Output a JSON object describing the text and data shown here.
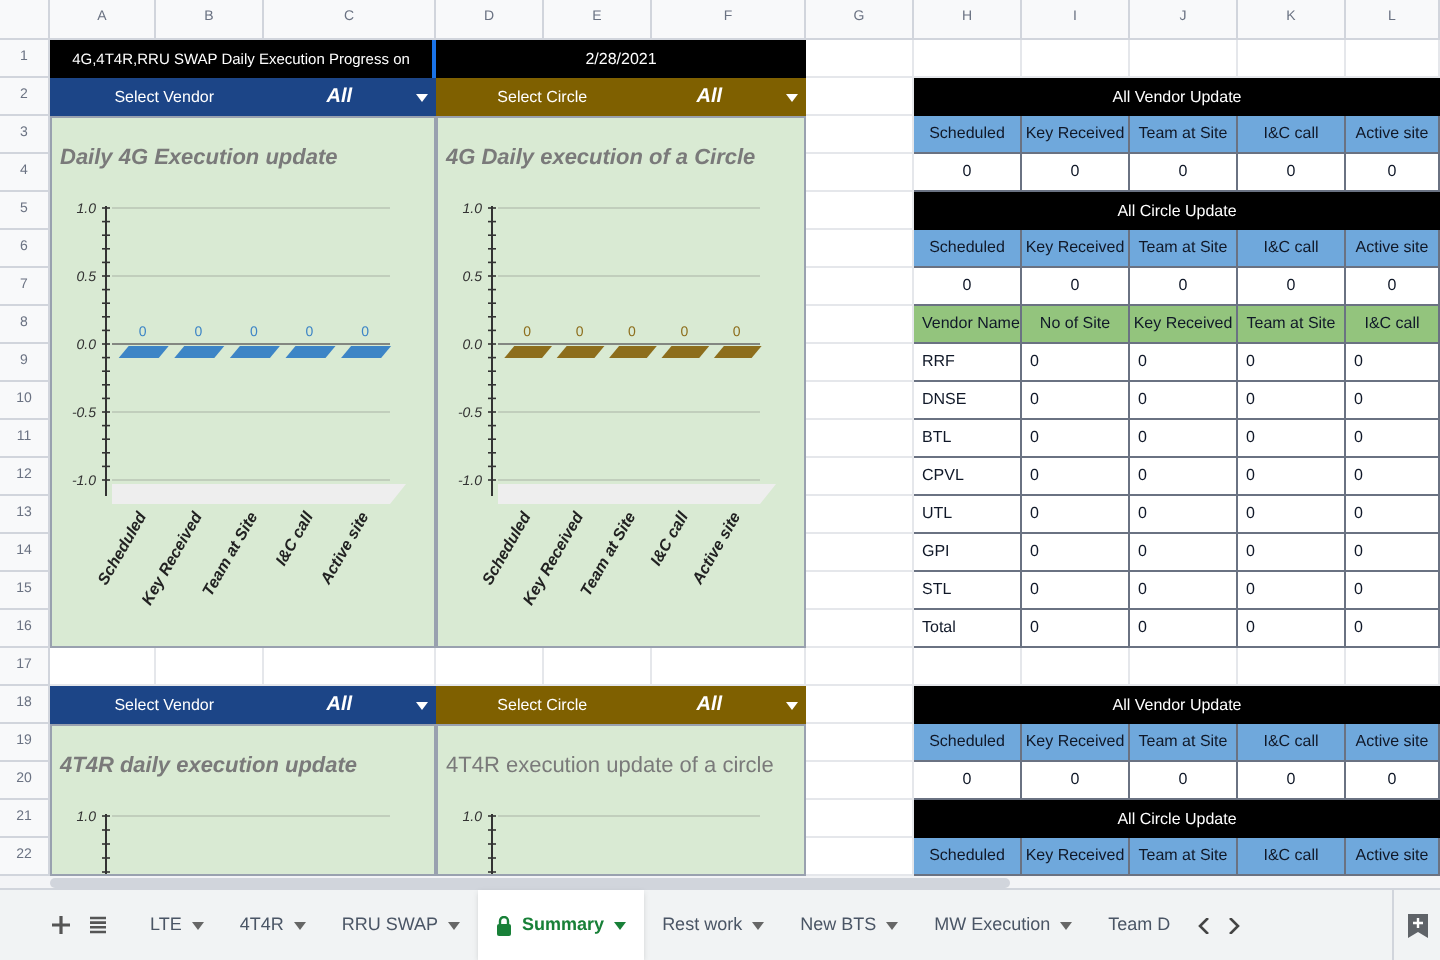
{
  "sheet": {
    "column_headers": [
      "A",
      "B",
      "C",
      "D",
      "E",
      "F",
      "G",
      "H",
      "I",
      "J",
      "K",
      "L"
    ],
    "row_numbers": [
      "1",
      "2",
      "3",
      "4",
      "5",
      "6",
      "7",
      "8",
      "9",
      "10",
      "11",
      "12",
      "13",
      "14",
      "15",
      "16",
      "17",
      "18",
      "19",
      "20",
      "21",
      "22"
    ]
  },
  "header": {
    "title": "4G,4T4R,RRU SWAP Daily Execution Progress on",
    "date": "2/28/2021"
  },
  "top_filters": [
    {
      "kind": "vendor",
      "label": "Select Vendor",
      "value": "All"
    },
    {
      "kind": "circle",
      "label": "Select Circle",
      "value": "All"
    }
  ],
  "top_charts": [
    {
      "title": "Daily 4G Execution update",
      "title_italic": true,
      "chart_data": {
        "type": "bar",
        "categories": [
          "Scheduled",
          "Key Received",
          "Team at Site",
          "I&C call",
          "Active site"
        ],
        "series": [
          {
            "color": "#3d85c6",
            "values": [
              0,
              0,
              0,
              0,
              0
            ]
          }
        ],
        "ylim": [
          -1,
          1
        ],
        "yticks": [
          {
            "value": 1,
            "label": "1.0"
          },
          {
            "value": 0.5,
            "label": "0.5"
          },
          {
            "value": 0,
            "label": "0.0"
          },
          {
            "value": -0.5,
            "label": "-0.5"
          },
          {
            "value": -1,
            "label": "-1.0"
          }
        ],
        "data_labels": true
      }
    },
    {
      "title": "4G Daily execution of a Circle",
      "title_italic": true,
      "chart_data": {
        "type": "bar",
        "categories": [
          "Scheduled",
          "Key Received",
          "Team at Site",
          "I&C call",
          "Active site"
        ],
        "series": [
          {
            "color": "#8d6e1c",
            "values": [
              0,
              0,
              0,
              0,
              0
            ]
          }
        ],
        "ylim": [
          -1,
          1
        ],
        "yticks": [
          {
            "value": 1,
            "label": "1.0"
          },
          {
            "value": 0.5,
            "label": "0.5"
          },
          {
            "value": 0,
            "label": "0.0"
          },
          {
            "value": -0.5,
            "label": "-0.5"
          },
          {
            "value": -1,
            "label": "-1.0"
          }
        ],
        "data_labels": true
      }
    }
  ],
  "bottom_filters": [
    {
      "kind": "vendor",
      "label": "Select Vendor",
      "value": "All"
    },
    {
      "kind": "circle",
      "label": "Select Circle",
      "value": "All"
    }
  ],
  "bottom_charts": [
    {
      "title": "4T4R daily execution update",
      "title_italic": true,
      "visible_tick": "1.0"
    },
    {
      "title": "4T4R execution update of a circle",
      "title_italic": false,
      "visible_tick": "1.0"
    }
  ],
  "summary_blocks": [
    {
      "rows": [
        {
          "kind": "title",
          "text": "All Vendor Update"
        },
        {
          "kind": "header",
          "cells": [
            "Scheduled",
            "Key Received",
            "Team at Site",
            "I&C call",
            "Active site"
          ]
        },
        {
          "kind": "values",
          "cells": [
            "0",
            "0",
            "0",
            "0",
            "0"
          ]
        },
        {
          "kind": "title",
          "text": "All Circle Update"
        },
        {
          "kind": "header",
          "cells": [
            "Scheduled",
            "Key Received",
            "Team at Site",
            "I&C call",
            "Active site"
          ]
        },
        {
          "kind": "values",
          "cells": [
            "0",
            "0",
            "0",
            "0",
            "0"
          ]
        },
        {
          "kind": "green_header",
          "cells": [
            "Vendor Name",
            "No of Site",
            "Key Received",
            "Team at Site",
            "I&C call"
          ]
        },
        {
          "kind": "row",
          "cells": [
            "RRF",
            "0",
            "0",
            "0",
            "0"
          ]
        },
        {
          "kind": "row",
          "cells": [
            "DNSE",
            "0",
            "0",
            "0",
            "0"
          ]
        },
        {
          "kind": "row",
          "cells": [
            "BTL",
            "0",
            "0",
            "0",
            "0"
          ]
        },
        {
          "kind": "row",
          "cells": [
            "CPVL",
            "0",
            "0",
            "0",
            "0"
          ]
        },
        {
          "kind": "row",
          "cells": [
            "UTL",
            "0",
            "0",
            "0",
            "0"
          ]
        },
        {
          "kind": "row",
          "cells": [
            "GPI",
            "0",
            "0",
            "0",
            "0"
          ]
        },
        {
          "kind": "row",
          "cells": [
            "STL",
            "0",
            "0",
            "0",
            "0"
          ]
        },
        {
          "kind": "row",
          "cells": [
            "Total",
            "0",
            "0",
            "0",
            "0"
          ]
        }
      ]
    },
    {
      "rows": [
        {
          "kind": "title",
          "text": "All Vendor Update"
        },
        {
          "kind": "header",
          "cells": [
            "Scheduled",
            "Key Received",
            "Team at Site",
            "I&C call",
            "Active site"
          ]
        },
        {
          "kind": "values",
          "cells": [
            "0",
            "0",
            "0",
            "0",
            "0"
          ]
        },
        {
          "kind": "title",
          "text": "All Circle Update"
        },
        {
          "kind": "header",
          "cells": [
            "Scheduled",
            "Key Received",
            "Team at Site",
            "I&C call",
            "Active site"
          ]
        }
      ]
    }
  ],
  "sheet_tabs": [
    {
      "label": "LTE",
      "selected": false,
      "locked": false,
      "caret": true
    },
    {
      "label": "4T4R",
      "selected": false,
      "locked": false,
      "caret": true
    },
    {
      "label": "RRU SWAP",
      "selected": false,
      "locked": false,
      "caret": true
    },
    {
      "label": "Summary",
      "selected": true,
      "locked": true,
      "caret": true
    },
    {
      "label": "Rest work",
      "selected": false,
      "locked": false,
      "caret": true
    },
    {
      "label": "New BTS",
      "selected": false,
      "locked": false,
      "caret": true
    },
    {
      "label": "MW Execution",
      "selected": false,
      "locked": false,
      "caret": true
    },
    {
      "label": "Team D",
      "selected": false,
      "locked": false,
      "caret": false
    }
  ]
}
